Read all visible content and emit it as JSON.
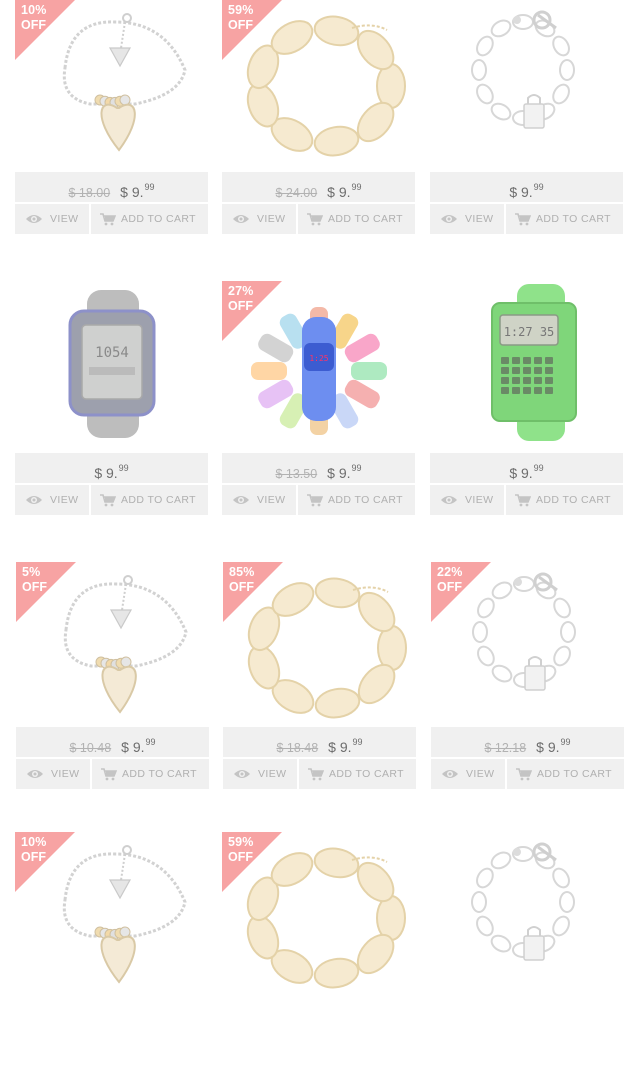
{
  "labels": {
    "view": "VIEW",
    "add_to_cart": "ADD TO CART",
    "off": "OFF"
  },
  "colors": {
    "ribbon": "#f7a3a3",
    "panel": "#f0f0f0"
  },
  "products": [
    {
      "image": "heart-bracelet",
      "discount": "10%",
      "old_price": "$ 18.00",
      "price_main": "$ 9.",
      "price_cents": "99"
    },
    {
      "image": "gold-chain-bracelet",
      "discount": "59%",
      "old_price": "$ 24.00",
      "price_main": "$ 9.",
      "price_cents": "99"
    },
    {
      "image": "silver-lock-bracelet",
      "discount": "",
      "old_price": "",
      "price_main": "$ 9.",
      "price_cents": "99"
    },
    {
      "image": "digital-watch",
      "discount": "",
      "old_price": "",
      "price_main": "$ 9.",
      "price_cents": "99"
    },
    {
      "image": "led-watch-colors",
      "discount": "27%",
      "old_price": "$ 13.50",
      "price_main": "$ 9.",
      "price_cents": "99"
    },
    {
      "image": "calculator-watch",
      "discount": "",
      "old_price": "",
      "price_main": "$ 9.",
      "price_cents": "99"
    },
    {
      "image": "heart-bracelet",
      "discount": "5%",
      "old_price": "$ 10.48",
      "price_main": "$ 9.",
      "price_cents": "99"
    },
    {
      "image": "gold-chain-bracelet",
      "discount": "85%",
      "old_price": "$ 18.48",
      "price_main": "$ 9.",
      "price_cents": "99"
    },
    {
      "image": "silver-lock-bracelet",
      "discount": "22%",
      "old_price": "$ 12.18",
      "price_main": "$ 9.",
      "price_cents": "99"
    },
    {
      "image": "heart-bracelet",
      "discount": "10%",
      "old_price": "",
      "price_main": "",
      "price_cents": ""
    },
    {
      "image": "gold-chain-bracelet",
      "discount": "59%",
      "old_price": "",
      "price_main": "",
      "price_cents": ""
    },
    {
      "image": "silver-lock-bracelet",
      "discount": "",
      "old_price": "",
      "price_main": "",
      "price_cents": ""
    }
  ]
}
